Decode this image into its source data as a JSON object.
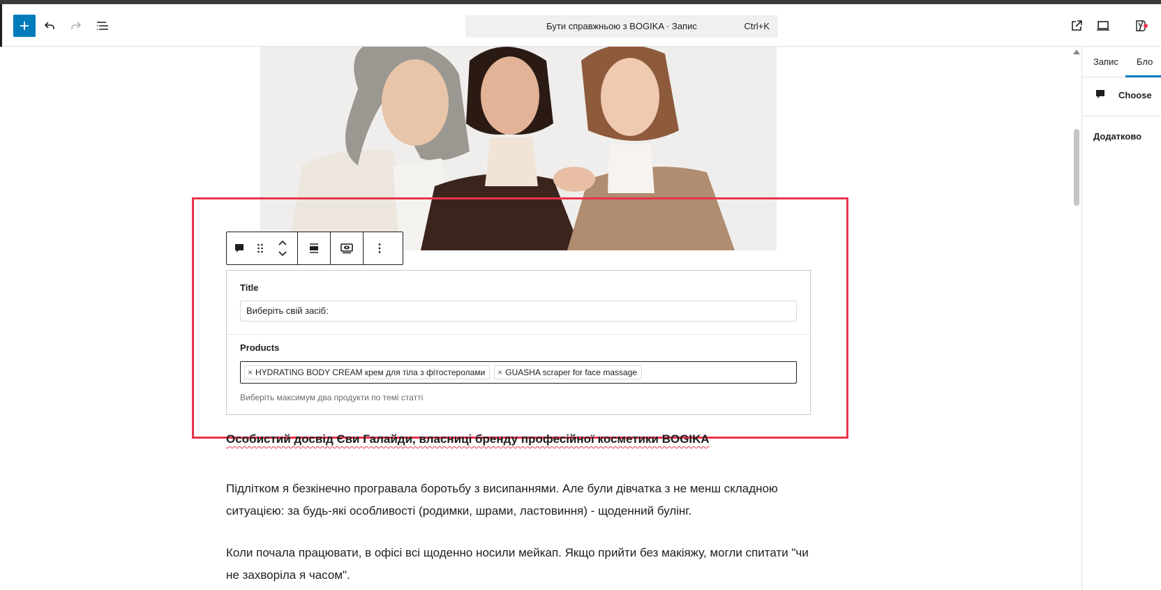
{
  "header": {
    "command_title": "Бути справжньою з BOGIKA · Запис",
    "command_shortcut": "Ctrl+K",
    "icons": [
      "plus-icon",
      "undo-icon",
      "redo-icon",
      "document-overview-icon",
      "external-link-icon",
      "preview-device-icon",
      "yoast-icon"
    ]
  },
  "block": {
    "title_label": "Title",
    "title_value": "Виберіть свій засіб:",
    "products_label": "Products",
    "products": [
      "HYDRATING BODY CREAM крем для тіла з фітостеролами",
      "GUASHA scraper for face massage"
    ],
    "token_remove": "×",
    "help_text": "Виберіть максимум два продукти по темі статті"
  },
  "content": {
    "heading": "Особистий досвід Єви Галайди, власниці бренду професійної косметики BOGIKA",
    "para1": "Підлітком я безкінечно програвала боротьбу з висипаннями. Але були дівчатка з не менш складною ситуацією: за будь-які особливості (родимки, шрами, ластовиння) - щоденний булінг.",
    "para2": "Коли почала працювати, в офісі всі щоденно носили мейкап. Якщо прийти без макіяжу, могли спитати \"чи не захворіла я часом\"."
  },
  "sidebar": {
    "tab_post": "Запис",
    "tab_block": "Бло",
    "block_label": "Choose",
    "advanced": "Додатково"
  },
  "colors": {
    "accent": "#007cba",
    "highlight": "#e8344a"
  }
}
